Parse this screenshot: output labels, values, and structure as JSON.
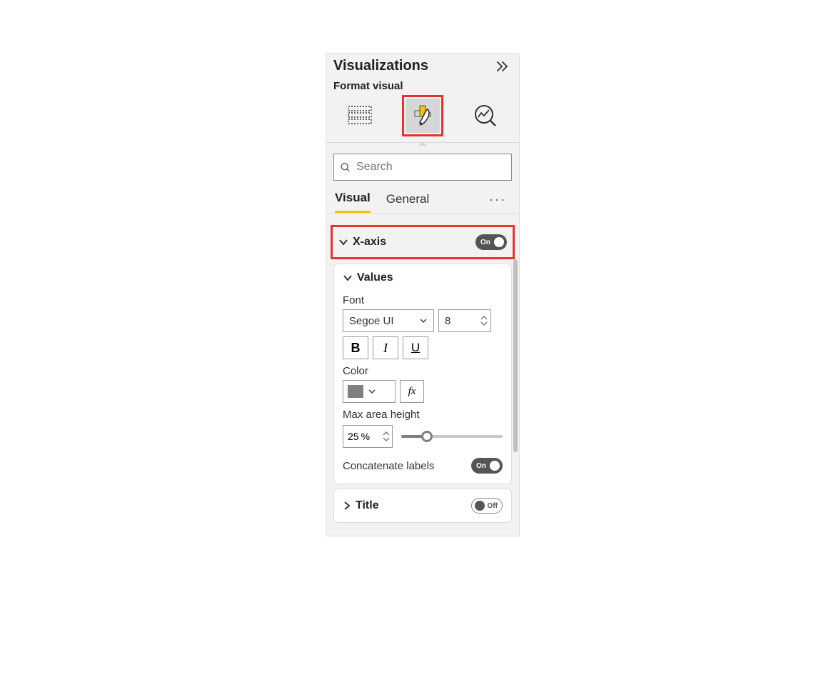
{
  "panel": {
    "title": "Visualizations",
    "subtitle": "Format visual"
  },
  "search": {
    "placeholder": "Search"
  },
  "tabs": {
    "visual": "Visual",
    "general": "General"
  },
  "xaxis": {
    "label": "X-axis",
    "toggle_label": "On"
  },
  "values": {
    "header": "Values",
    "font_label": "Font",
    "font_family": "Segoe UI",
    "font_size": "8",
    "bold": "B",
    "italic": "I",
    "underline": "U",
    "color_label": "Color",
    "color_hex": "#808080",
    "fx": "fx",
    "max_area_label": "Max area height",
    "max_area_value": "25",
    "max_area_unit": "%",
    "concat_label": "Concatenate labels",
    "concat_toggle": "On"
  },
  "title_section": {
    "label": "Title",
    "toggle_label": "Off"
  }
}
